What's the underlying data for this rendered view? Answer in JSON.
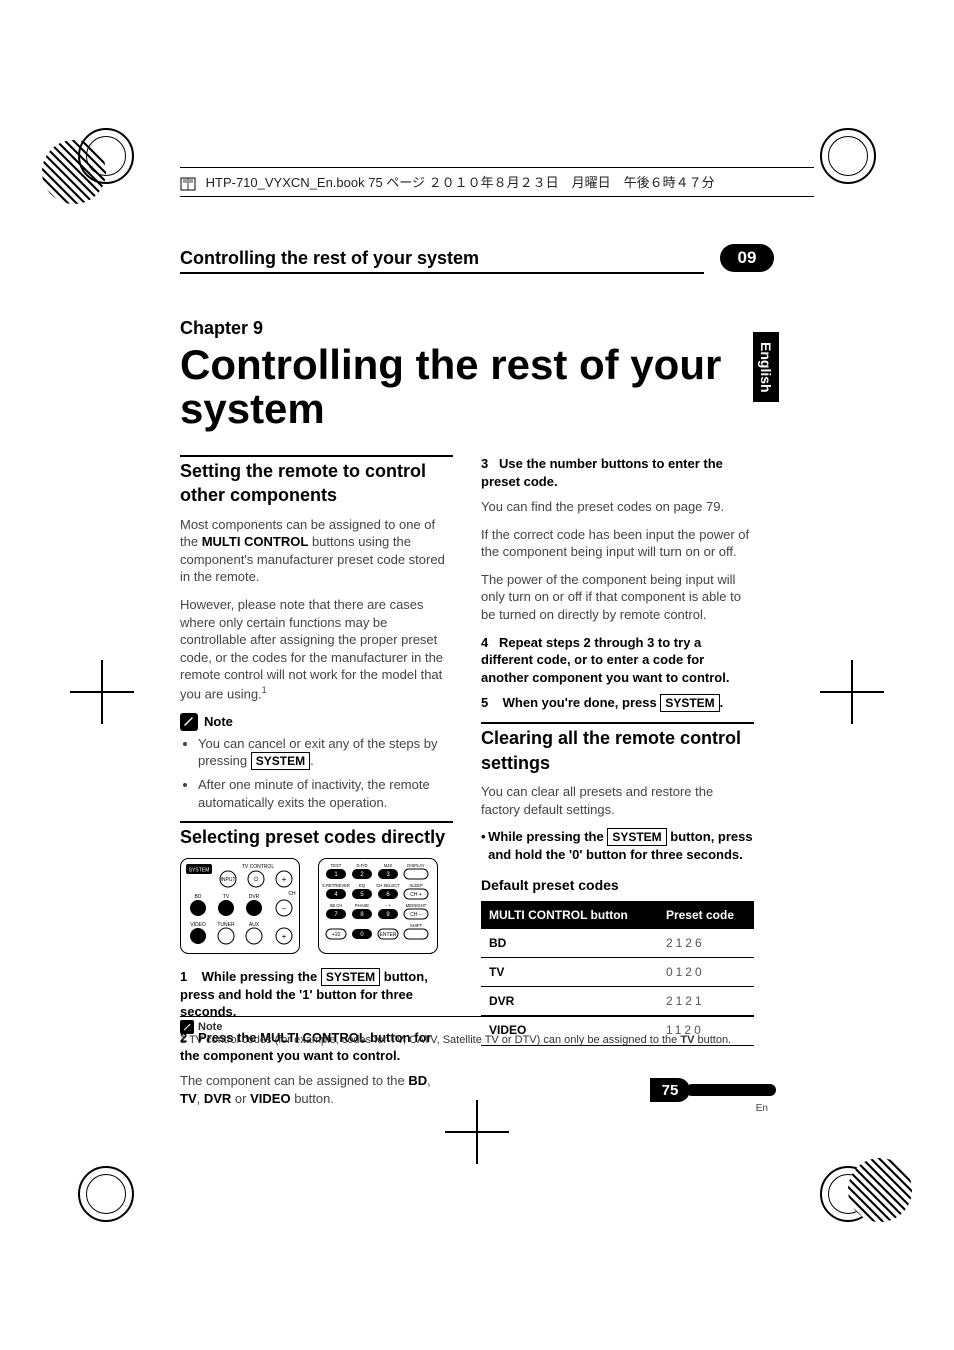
{
  "meta": {
    "header_text": "HTP-710_VYXCN_En.book  75 ページ  ２０１０年８月２３日　月曜日　午後６時４７分"
  },
  "running_header": {
    "title": "Controlling the rest of your system",
    "chapter_badge": "09"
  },
  "language_tab": "English",
  "chapter": {
    "label": "Chapter 9",
    "title": "Controlling the rest of your system"
  },
  "left_col": {
    "h2_1": "Setting the remote to control other components",
    "p1": "Most components can be assigned to one of the ",
    "p1_b": "MULTI CONTROL",
    "p1_tail": " buttons using the component's manufacturer preset code stored in the remote.",
    "p2": "However, please note that there are cases where only certain functions may be controllable after assigning the proper preset code, or the codes for the manufacturer in the remote control will not work for the model that you are using.",
    "p2_sup": "1",
    "note_label": "Note",
    "note_b1_a": "You can cancel or exit any of the steps by pressing ",
    "note_b1_key": "SYSTEM",
    "note_b1_tail": ".",
    "note_b2": "After one minute of inactivity, the remote automatically exits the operation.",
    "h2_2": "Selecting preset codes directly",
    "step1_a": "While pressing the ",
    "step1_key": "SYSTEM",
    "step1_b": " button, press and hold the '1' button for three seconds.",
    "step2": "Press the MULTI CONTROL button for the component you want to control.",
    "step2_body_a": "The component can be assigned to the ",
    "step2_body_b": "BD",
    "step2_body_c": ", ",
    "step2_body_d": "TV",
    "step2_body_e": ", ",
    "step2_body_f": "DVR",
    "step2_body_g": " or ",
    "step2_body_h": "VIDEO",
    "step2_body_i": " button."
  },
  "right_col": {
    "step3": "Use the number buttons to enter the preset code.",
    "step3_body": "You can find the preset codes on page 79.",
    "p4": "If the correct code has been input the power of the component being input will turn on or off.",
    "p5": "The power of the component being input will only turn on or off if that component is able to be turned on directly by remote control.",
    "step4": "Repeat steps 2 through 3 to try a different code, or to enter a code for another component you want to control.",
    "step5_a": "When you're done, press ",
    "step5_key": "SYSTEM",
    "step5_tail": ".",
    "h2": "Clearing all the remote control settings",
    "p6": "You can clear all presets and restore the factory default settings.",
    "bullet_a": "While pressing the ",
    "bullet_key": "SYSTEM",
    "bullet_b": " button, press and hold the '0' button for three seconds.",
    "table_heading": "Default preset codes",
    "table": {
      "head_button": "MULTI CONTROL button",
      "head_code": "Preset code",
      "rows": [
        {
          "button": "BD",
          "code": "2126"
        },
        {
          "button": "TV",
          "code": "0120"
        },
        {
          "button": "DVR",
          "code": "2121"
        },
        {
          "button": "VIDEO",
          "code": "1120"
        }
      ]
    }
  },
  "footnote": {
    "label": "Note",
    "text": "1 TV control codes (for example, codes for TV, CATV, Satellite TV or DTV) can only be assigned to the ",
    "bold": "TV",
    "tail": " button."
  },
  "page_number": "75",
  "page_number_label": "En",
  "remote_labels": {
    "system": "SYSTEM",
    "tv_control": "TV CONTROL",
    "input": "INPUT",
    "ch": "CH",
    "bd": "BD",
    "tv": "TV",
    "dvr": "DVR",
    "video": "VIDEO",
    "tuner": "TUNER",
    "aux": "AUX",
    "test": "TEST",
    "d_fd": "D.F/D",
    "mjx": "MJX",
    "display": "DISPLAY",
    "sretriever": "S.RETRIEVER",
    "eq": "EQ",
    "chselect": "CH SELECT",
    "sleep": "SLEEP",
    "sbch": "SB CH",
    "phase": "PHASE",
    "midnight": "MIDNIGHT",
    "plus_minus": "– +",
    "ch_plus": "CH +",
    "ch_minus": "CH –",
    "shift": "SHIFT",
    "plus10": "+10",
    "enter": "ENTER",
    "n1": "1",
    "n2": "2",
    "n3": "3",
    "n4": "4",
    "n5": "5",
    "n6": "6",
    "n7": "7",
    "n8": "8",
    "n9": "9",
    "n0": "0"
  }
}
